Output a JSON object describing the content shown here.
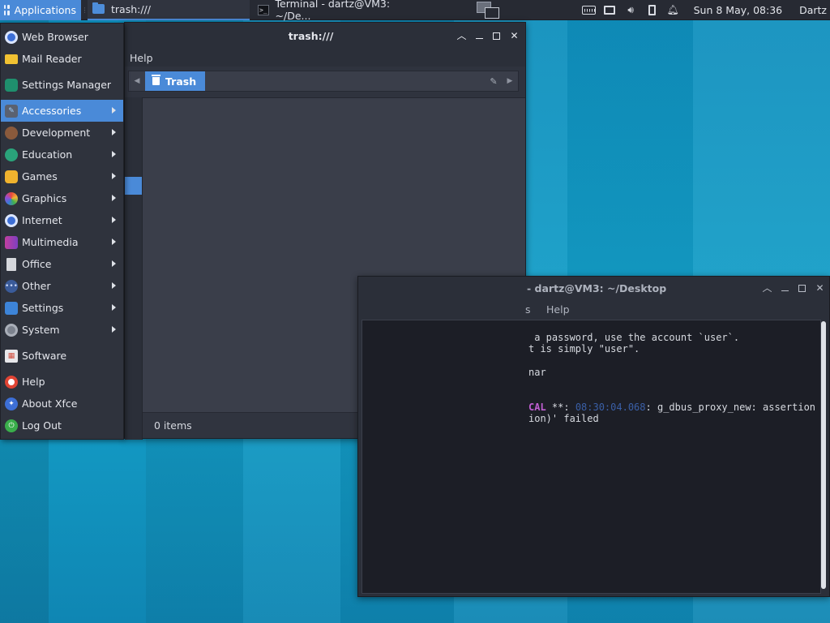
{
  "panel": {
    "applications_label": "Applications",
    "tasks": [
      {
        "label": "trash:///",
        "icon": "folder-icon",
        "active": true
      },
      {
        "label": "Terminal - dartz@VM3: ~/De...",
        "icon": "terminal-icon",
        "active": false
      }
    ],
    "clock": "Sun  8 May, 08:36",
    "user": "Dartz",
    "tray_icons": [
      "keyboard-icon",
      "screen-icon",
      "volume-icon",
      "battery-icon",
      "notification-bell-icon"
    ]
  },
  "menu": {
    "items": [
      {
        "label": "Web Browser",
        "icon": "web-browser-icon",
        "submenu": false
      },
      {
        "label": "Mail Reader",
        "icon": "mail-icon",
        "submenu": false
      },
      {
        "label": "Settings Manager",
        "icon": "settings-manager-icon",
        "submenu": false
      },
      {
        "label": "Accessories",
        "icon": "accessories-icon",
        "submenu": true,
        "selected": true
      },
      {
        "label": "Development",
        "icon": "development-icon",
        "submenu": true
      },
      {
        "label": "Education",
        "icon": "education-icon",
        "submenu": true
      },
      {
        "label": "Games",
        "icon": "games-icon",
        "submenu": true
      },
      {
        "label": "Graphics",
        "icon": "graphics-icon",
        "submenu": true
      },
      {
        "label": "Internet",
        "icon": "internet-icon",
        "submenu": true
      },
      {
        "label": "Multimedia",
        "icon": "multimedia-icon",
        "submenu": true
      },
      {
        "label": "Office",
        "icon": "office-icon",
        "submenu": true
      },
      {
        "label": "Other",
        "icon": "other-icon",
        "submenu": true
      },
      {
        "label": "Settings",
        "icon": "settings-icon",
        "submenu": true
      },
      {
        "label": "System",
        "icon": "system-icon",
        "submenu": true
      },
      {
        "label": "Software",
        "icon": "software-icon",
        "submenu": false
      },
      {
        "label": "Help",
        "icon": "help-icon",
        "submenu": false
      },
      {
        "label": "About Xfce",
        "icon": "about-xfce-icon",
        "submenu": false
      },
      {
        "label": "Log Out",
        "icon": "log-out-icon",
        "submenu": false
      }
    ]
  },
  "file_manager": {
    "title": "trash:///",
    "menu_help": "Help",
    "breadcrumb": "Trash",
    "status": "0 items"
  },
  "terminal": {
    "title": "- dartz@VM3: ~/Desktop",
    "menu": [
      "s",
      "Help"
    ],
    "lines": [
      {
        "text": " a password, use the account `user`."
      },
      {
        "text": "t is simply \"user\"."
      },
      {
        "text": ""
      },
      {
        "text": "nar"
      },
      {
        "text": ""
      },
      {
        "text": ""
      },
      {
        "crit": "CAL",
        "mid": " **: ",
        "ts": "08:30:04.068",
        "rest": ": g_dbus_proxy_new: assertion '"
      },
      {
        "text": "ion)' failed"
      }
    ]
  },
  "colors": {
    "accent": "#4a8ad8",
    "panel_bg": "#272a33",
    "window_bg": "#2f333e",
    "desktop": "#1691b8"
  }
}
